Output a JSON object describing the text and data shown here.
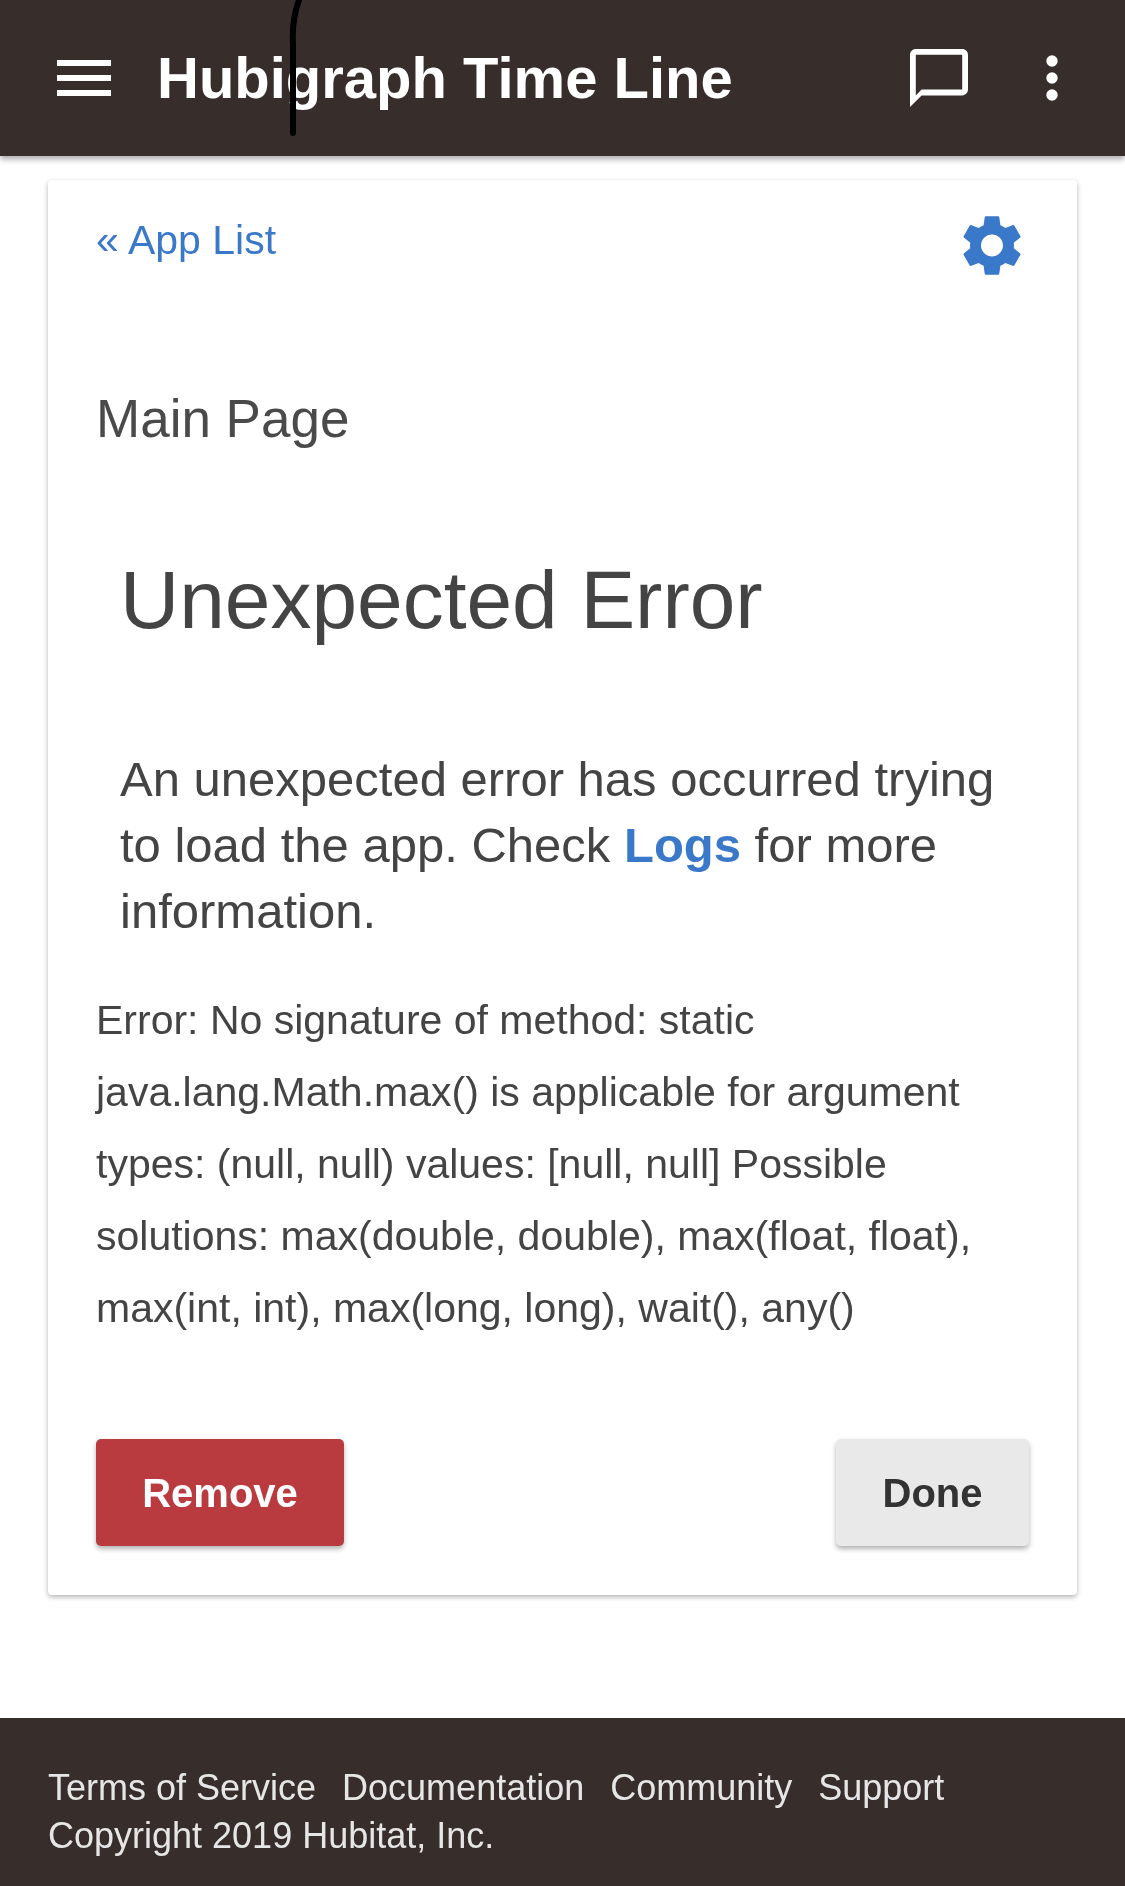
{
  "app_bar": {
    "title": "Hubigraph Time Line"
  },
  "card": {
    "back_link": {
      "label": "« App List"
    },
    "page_title": "Main Page",
    "error": {
      "heading": "Unexpected Error",
      "message": {
        "before": "An unexpected error has occurred trying to load the app. Check ",
        "link": "Logs",
        "after": " for more information."
      },
      "details": "Error: No signature of method: static java.lang.Math.max() is applicable for argument types: (null, null) values: [null, null] Possible solutions: max(double, double), max(float, float), max(int, int), max(long, long), wait(), any()"
    },
    "buttons": [
      {
        "label": "Remove",
        "kind": "danger"
      },
      {
        "label": "Done",
        "kind": "default"
      }
    ]
  },
  "footer": {
    "links": [
      "Terms of Service",
      "Documentation",
      "Community",
      "Support"
    ],
    "copyright": "Copyright 2019 Hubitat, Inc."
  }
}
